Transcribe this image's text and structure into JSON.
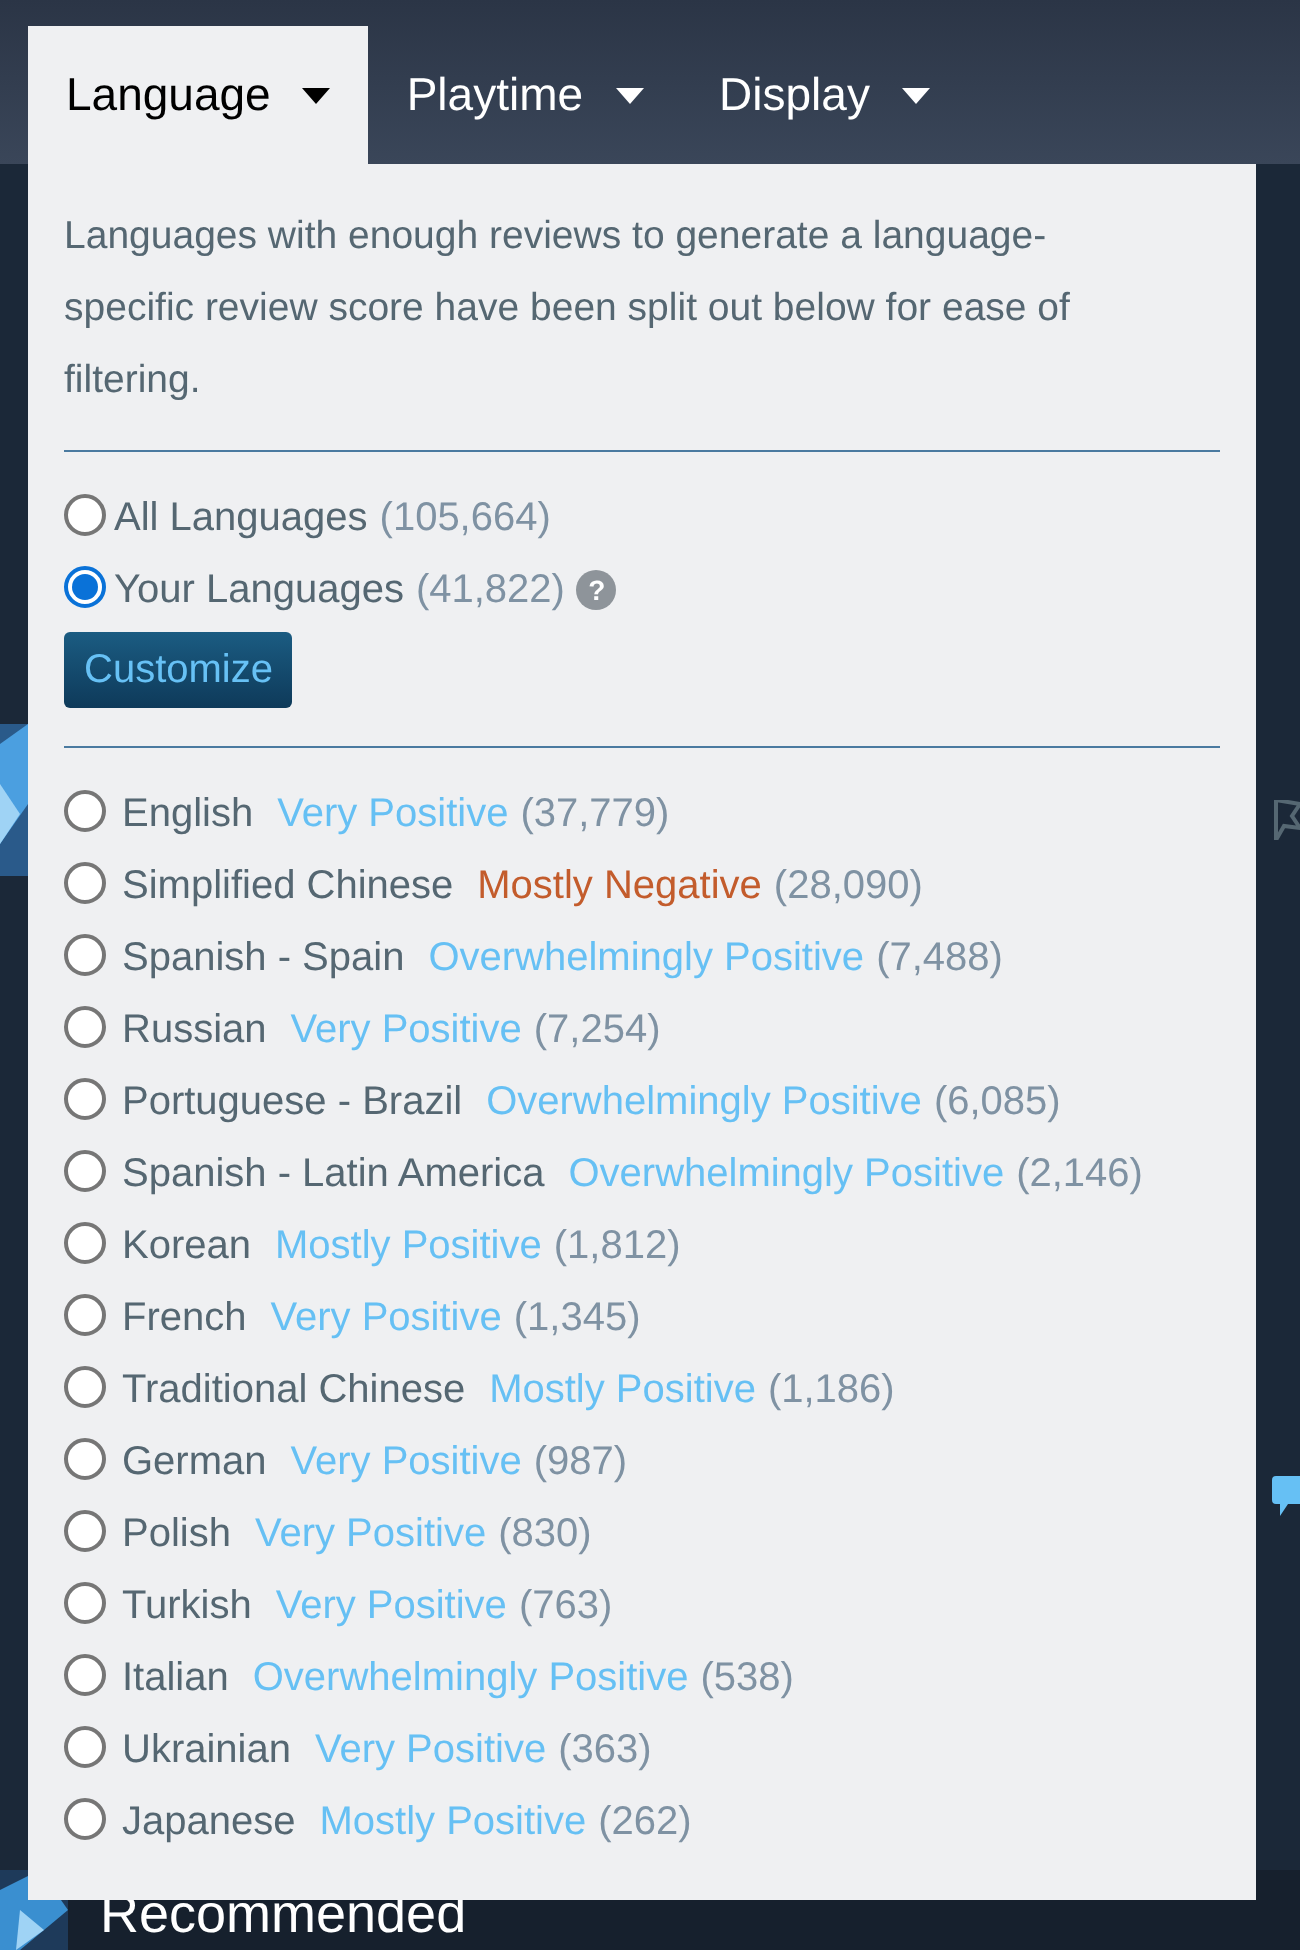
{
  "tabs": [
    {
      "label": "Language",
      "selected": true
    },
    {
      "label": "Playtime",
      "selected": false
    },
    {
      "label": "Display",
      "selected": false
    }
  ],
  "description": "Languages with enough reviews to generate a language-specific review score have been split out below for ease of filtering.",
  "summary_options": [
    {
      "label": "All Languages",
      "count": "(105,664)",
      "selected": false
    },
    {
      "label": "Your Languages",
      "count": "(41,822)",
      "selected": true,
      "help_icon": "?"
    }
  ],
  "customize_button": "Customize",
  "languages": [
    {
      "name": "English",
      "rating": "Very Positive",
      "color": "#66c0f4",
      "count": "(37,779)",
      "selected": false
    },
    {
      "name": "Simplified Chinese",
      "rating": "Mostly Negative",
      "color": "#c35c2c",
      "count": "(28,090)",
      "selected": false
    },
    {
      "name": "Spanish - Spain",
      "rating": "Overwhelmingly Positive",
      "color": "#66c0f4",
      "count": "(7,488)",
      "selected": false
    },
    {
      "name": "Russian",
      "rating": "Very Positive",
      "color": "#66c0f4",
      "count": "(7,254)",
      "selected": false
    },
    {
      "name": "Portuguese - Brazil",
      "rating": "Overwhelmingly Positive",
      "color": "#66c0f4",
      "count": "(6,085)",
      "selected": false
    },
    {
      "name": "Spanish - Latin America",
      "rating": "Overwhelmingly Positive",
      "color": "#66c0f4",
      "count": "(2,146)",
      "selected": false
    },
    {
      "name": "Korean",
      "rating": "Mostly Positive",
      "color": "#66c0f4",
      "count": "(1,812)",
      "selected": false
    },
    {
      "name": "French",
      "rating": "Very Positive",
      "color": "#66c0f4",
      "count": "(1,345)",
      "selected": false
    },
    {
      "name": "Traditional Chinese",
      "rating": "Mostly Positive",
      "color": "#66c0f4",
      "count": "(1,186)",
      "selected": false
    },
    {
      "name": "German",
      "rating": "Very Positive",
      "color": "#66c0f4",
      "count": "(987)",
      "selected": false
    },
    {
      "name": "Polish",
      "rating": "Very Positive",
      "color": "#66c0f4",
      "count": "(830)",
      "selected": false
    },
    {
      "name": "Turkish",
      "rating": "Very Positive",
      "color": "#66c0f4",
      "count": "(763)",
      "selected": false
    },
    {
      "name": "Italian",
      "rating": "Overwhelmingly Positive",
      "color": "#66c0f4",
      "count": "(538)",
      "selected": false
    },
    {
      "name": "Ukrainian",
      "rating": "Very Positive",
      "color": "#66c0f4",
      "count": "(363)",
      "selected": false
    },
    {
      "name": "Japanese",
      "rating": "Mostly Positive",
      "color": "#66c0f4",
      "count": "(262)",
      "selected": false
    }
  ],
  "background": {
    "heading": "Recommended"
  }
}
